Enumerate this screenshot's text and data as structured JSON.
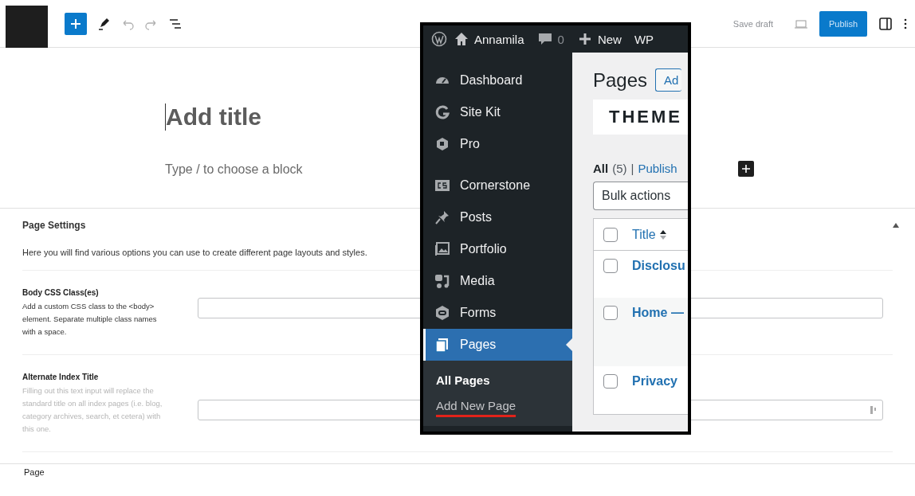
{
  "toolbar": {
    "save_draft": "Save draft",
    "publish": "Publish"
  },
  "editor": {
    "title": {
      "placeholder": "Add title"
    },
    "block": {
      "placeholder": "Type / to choose a block"
    }
  },
  "page_settings": {
    "title": "Page Settings",
    "expanded": true,
    "intro": "Here you will find various options you can use to create different page layouts and styles.",
    "fields": [
      {
        "label": "Body CSS Class(es)",
        "help": "Add a custom CSS class to the <body> element. Separate multiple class names with a space.",
        "muted": false,
        "kind": "text"
      },
      {
        "label": "Alternate Index Title",
        "help": "Filling out this text input will replace the standard title on all index pages (i.e. blog, category archives, search, et cetera) with this one.",
        "muted": true,
        "kind": "picker"
      }
    ]
  },
  "next_panel": {
    "title": "Page"
  },
  "inset": {
    "admin_bar": {
      "site": "Annamila",
      "comments": "0",
      "new": "New",
      "cut_item": "WP"
    },
    "menu": [
      {
        "label": "Dashboard",
        "selected": false
      },
      {
        "label": "Site Kit",
        "selected": false
      },
      {
        "label": "Pro",
        "selected": false
      },
      {
        "label": "Cornerstone",
        "selected": false
      },
      {
        "label": "Posts",
        "selected": false
      },
      {
        "label": "Portfolio",
        "selected": false
      },
      {
        "label": "Media",
        "selected": false
      },
      {
        "label": "Forms",
        "selected": false
      },
      {
        "label": "Pages",
        "selected": true
      }
    ],
    "submenu": [
      {
        "label": "All Pages",
        "selected": true,
        "underlined": false
      },
      {
        "label": "Add New Page",
        "selected": false,
        "underlined": true
      }
    ],
    "content": {
      "heading": "Pages",
      "add_button": "Ad",
      "logo": "THEME",
      "filter_all": "All",
      "filter_count": "(5)",
      "separator": "|",
      "filter_published": "Publish",
      "bulk_actions": "Bulk actions",
      "column_title": "Title",
      "rows": [
        {
          "title": "Disclosu",
          "checked": false
        },
        {
          "title": "Home —",
          "checked": false
        },
        {
          "title": "Privacy",
          "checked": false
        }
      ],
      "header_checked": false
    }
  }
}
